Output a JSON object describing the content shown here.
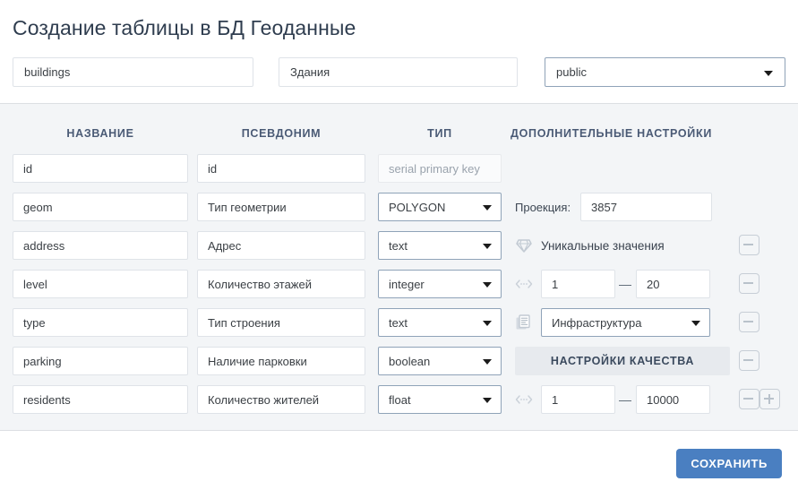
{
  "header": {
    "title": "Создание таблицы в БД Геоданные"
  },
  "top_fields": {
    "table_name": {
      "value": "buildings"
    },
    "table_alias": {
      "value": "Здания"
    },
    "schema": {
      "value": "public"
    }
  },
  "columns_header": {
    "name": "НАЗВАНИЕ",
    "alias": "ПСЕВДОНИМ",
    "type": "ТИП",
    "extra": "ДОПОЛНИТЕЛЬНЫЕ НАСТРОЙКИ"
  },
  "labels": {
    "projection": "Проекция:",
    "unique_values": "Уникальные значения",
    "quality_settings": "НАСТРОЙКИ КАЧЕСТВА",
    "range_dash": "—"
  },
  "rows": [
    {
      "name": "id",
      "alias": "id",
      "type": "serial primary key",
      "type_disabled": true,
      "extra": "none"
    },
    {
      "name": "geom",
      "alias": "Тип геометрии",
      "type": "POLYGON",
      "type_disabled": false,
      "extra": "projection",
      "projection": "3857"
    },
    {
      "name": "address",
      "alias": "Адрес",
      "type": "text",
      "type_disabled": false,
      "extra": "unique"
    },
    {
      "name": "level",
      "alias": "Количество этажей",
      "type": "integer",
      "type_disabled": false,
      "extra": "range",
      "min": "1",
      "max": "20"
    },
    {
      "name": "type",
      "alias": "Тип строения",
      "type": "text",
      "type_disabled": false,
      "extra": "dictionary",
      "dictionary": "Инфраструктура"
    },
    {
      "name": "parking",
      "alias": "Наличие парковки",
      "type": "boolean",
      "type_disabled": false,
      "extra": "quality"
    },
    {
      "name": "residents",
      "alias": "Количество жителей",
      "type": "float",
      "type_disabled": false,
      "extra": "range",
      "min": "1",
      "max": "10000"
    }
  ],
  "footer": {
    "save_label": "СОХРАНИТЬ"
  },
  "colors": {
    "accent": "#4a7fc1",
    "panel_bg": "#f3f5f7",
    "title": "#2f3d4f",
    "header_text": "#4a5a75",
    "focus_border": "#8fa3b8"
  },
  "icons": {
    "diamond": "diamond-icon",
    "range": "arrows-horizontal-icon",
    "dictionary": "document-list-icon",
    "caret": "chevron-down-icon",
    "minus": "minus-icon",
    "plus": "plus-icon"
  }
}
